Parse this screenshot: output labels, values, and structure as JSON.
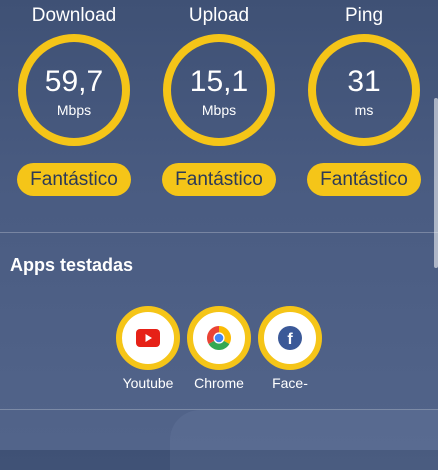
{
  "metrics": [
    {
      "title": "Download",
      "value": "59,7",
      "unit": "Mbps",
      "rating": "Fantástico"
    },
    {
      "title": "Upload",
      "value": "15,1",
      "unit": "Mbps",
      "rating": "Fantástico"
    },
    {
      "title": "Ping",
      "value": "31",
      "unit": "ms",
      "rating": "Fantástico"
    }
  ],
  "apps_section": {
    "title": "Apps testadas",
    "apps": [
      {
        "label": "Youtube",
        "icon": "youtube-icon"
      },
      {
        "label": "Chrome",
        "icon": "chrome-icon"
      },
      {
        "label": "Face-",
        "icon": "facebook-icon"
      }
    ]
  },
  "colors": {
    "accent": "#f5c518",
    "background": "#46587e",
    "rating_text": "#2c3a58"
  }
}
